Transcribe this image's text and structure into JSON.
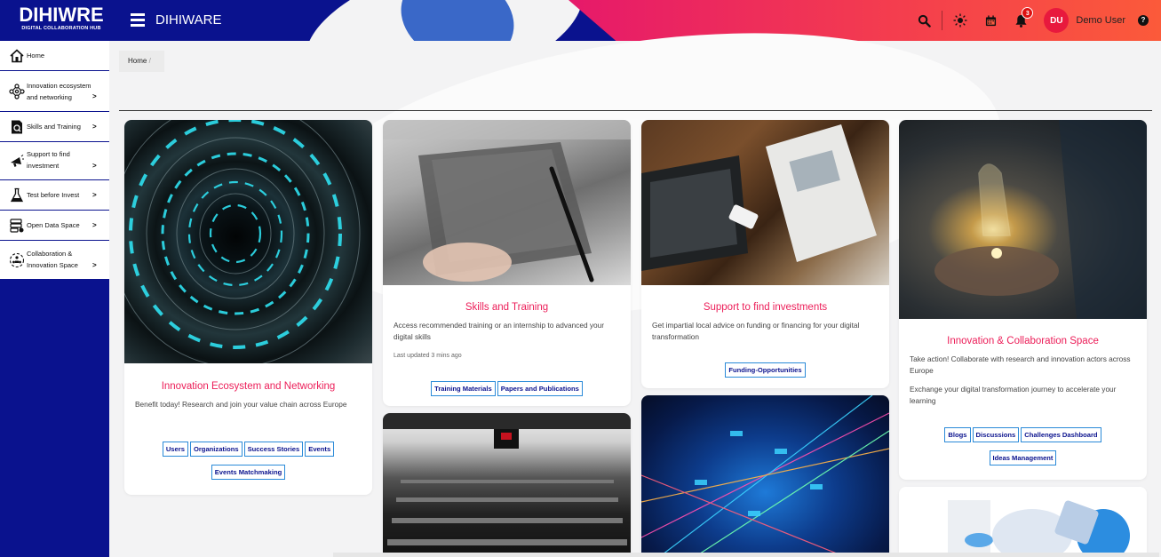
{
  "app": {
    "logo_main": "DIHIWRE",
    "logo_sub": "DIGITAL COLLABORATION HUB",
    "title": "DIHIWARE"
  },
  "topbar": {
    "notifications_count": "3",
    "user_initials": "DU",
    "user_name": "Demo User",
    "help": "?"
  },
  "sidebar": {
    "items": [
      {
        "icon": "home-icon",
        "label1": "Home",
        "label2": "",
        "chevron": ""
      },
      {
        "icon": "network-icon",
        "label1": "Innovation ecosystem",
        "label2": "and networking",
        "chevron": ">"
      },
      {
        "icon": "book-search-icon",
        "label1": "Skills and Training",
        "label2": "",
        "chevron": ">"
      },
      {
        "icon": "megaphone-icon",
        "label1": "Support to find",
        "label2": "investment",
        "chevron": ">"
      },
      {
        "icon": "flask-icon",
        "label1": "Test before Invest",
        "label2": "",
        "chevron": ">"
      },
      {
        "icon": "database-icon",
        "label1": "Open Data Space",
        "label2": "",
        "chevron": ">"
      },
      {
        "icon": "collaboration-icon",
        "label1": "Collaboration &",
        "label2": "Innovation Space",
        "chevron": ">"
      }
    ]
  },
  "breadcrumb": {
    "home": "Home",
    "separator": "/"
  },
  "cards": {
    "innovation": {
      "title": "Innovation Ecosystem and Networking",
      "desc": "Benefit today! Research and join your value chain across Europe",
      "tags": [
        "Users",
        "Organizations",
        "Success Stories",
        "Events",
        "Events Matchmaking"
      ]
    },
    "skills": {
      "title": "Skills and Training",
      "desc": "Access recommended training or an internship to advanced your digital skills",
      "meta": "Last updated 3 mins ago",
      "tags": [
        "Training Materials",
        "Papers and Publications"
      ]
    },
    "investments": {
      "title": "Support to find investments",
      "desc": "Get impartial local advice on funding or financing for your digital transformation",
      "tags": [
        "Funding-Opportunities"
      ]
    },
    "collab": {
      "title": "Innovation & Collaboration Space",
      "desc1": "Take action! Collaborate with research and innovation actors across Europe",
      "desc2": "Exchange your digital transformation journey to accelerate your learning",
      "tags": [
        "Blogs",
        "Discussions",
        "Challenges Dashboard",
        "Ideas Management"
      ]
    }
  }
}
